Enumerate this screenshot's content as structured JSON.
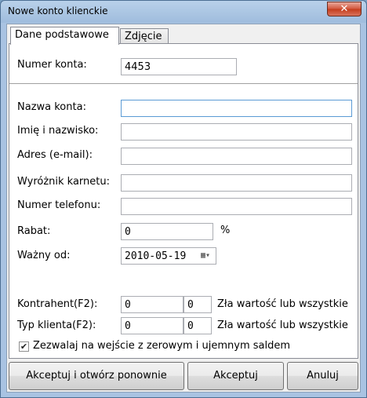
{
  "window": {
    "title": "Nowe konto klienckie",
    "close_label": "✕"
  },
  "tabs": [
    {
      "label": "Dane podstawowe"
    },
    {
      "label": "Zdjęcie"
    }
  ],
  "form": {
    "account_number_label": "Numer konta:",
    "account_number_value": "4453",
    "account_name_label": "Nazwa konta:",
    "account_name_value": "",
    "full_name_label": "Imię i nazwisko:",
    "full_name_value": "",
    "email_label": "Adres (e-mail):",
    "email_value": "",
    "ticket_marker_label": "Wyróżnik karnetu:",
    "ticket_marker_value": "",
    "phone_label": "Numer telefonu:",
    "phone_value": "",
    "discount_label": "Rabat:",
    "discount_value": "0",
    "discount_unit": "%",
    "valid_from_label": "Ważny od:",
    "valid_from_value": "2010-05-19",
    "contractor_label": "Kontrahent(F2):",
    "contractor_value1": "0",
    "contractor_value2": "0",
    "contractor_status": "Zła wartość lub wszystkie",
    "client_type_label": "Typ klienta(F2):",
    "client_type_value1": "0",
    "client_type_value2": "0",
    "client_type_status": "Zła wartość lub wszystkie",
    "allow_entry_label": "Zezwalaj na wejście z zerowym i ujemnym saldem",
    "allow_entry_checked": true
  },
  "buttons": {
    "accept_reopen": "Akceptuj i otwórz ponownie",
    "accept": "Akceptuj",
    "cancel": "Anuluj"
  }
}
